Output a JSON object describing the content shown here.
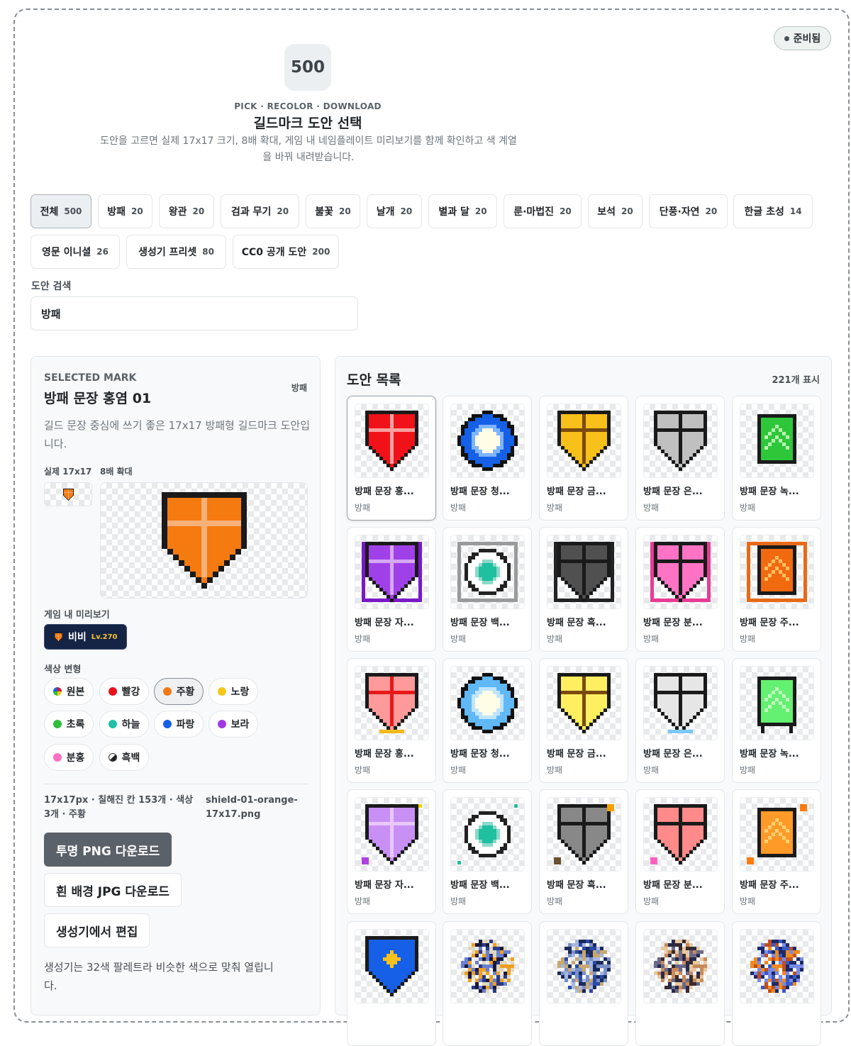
{
  "status": {
    "label": "준비됨"
  },
  "hero": {
    "count": "500",
    "eyebrow": "PICK · RECOLOR · DOWNLOAD",
    "title": "길드마크 도안 선택",
    "description": "도안을 고르면 실제 17x17 크기, 8배 확대, 게임 내 네임플레이트 미리보기를 함께 확인하고 색 계열을 바꿔 내려받습니다."
  },
  "filters": [
    {
      "label": "전체",
      "count": "500",
      "active": true
    },
    {
      "label": "방패",
      "count": "20"
    },
    {
      "label": "왕관",
      "count": "20"
    },
    {
      "label": "검과 무기",
      "count": "20"
    },
    {
      "label": "불꽃",
      "count": "20"
    },
    {
      "label": "날개",
      "count": "20"
    },
    {
      "label": "별과 달",
      "count": "20"
    },
    {
      "label": "룬·마법진",
      "count": "20"
    },
    {
      "label": "보석",
      "count": "20"
    },
    {
      "label": "단풍·자연",
      "count": "20"
    },
    {
      "label": "한글 초성",
      "count": "14"
    },
    {
      "label": "영문 이니셜",
      "count": "26"
    },
    {
      "label": "생성기 프리셋",
      "count": "80"
    },
    {
      "label": "CC0 공개 도안",
      "count": "200"
    }
  ],
  "search": {
    "label": "도안 검색",
    "value": "방패"
  },
  "selected": {
    "eyebrow": "SELECTED MARK",
    "title": "방패 문장 홍염 01",
    "category": "방패",
    "description": "길드 문장 중심에 쓰기 좋은 17x17 방패형 길드마크 도안입니다.",
    "actual_label": "실제 17x17",
    "zoom_label": "8배 확대",
    "preview_label": "게임 내 미리보기",
    "nameplate": {
      "name": "비비",
      "level": "Lv.270"
    },
    "color_label": "색상 변형",
    "swatches": [
      {
        "label": "원본",
        "color": "multi"
      },
      {
        "label": "빨강",
        "color": "#e8121c"
      },
      {
        "label": "주황",
        "color": "#f07a16",
        "active": true
      },
      {
        "label": "노랑",
        "color": "#f7c61a"
      },
      {
        "label": "초록",
        "color": "#2ebf3a"
      },
      {
        "label": "하늘",
        "color": "#1fc2a8"
      },
      {
        "label": "파랑",
        "color": "#1561e8"
      },
      {
        "label": "보라",
        "color": "#9d3be0"
      },
      {
        "label": "분홍",
        "color": "#ff6fc2"
      },
      {
        "label": "흑백",
        "color": "mono"
      }
    ],
    "meta": "17x17px · 칠해진 칸 153개 · 색상 3개 · 주황",
    "filename": "shield-01-orange-17x17.png",
    "buttons": {
      "png": "투명 PNG 다운로드",
      "jpg": "흰 배경 JPG 다운로드",
      "edit": "생성기에서 편집"
    },
    "note": "생성기는 32색 팔레트라 비슷한 색으로 맞춰 열립니다."
  },
  "list": {
    "title": "도안 목록",
    "count": "221개 표시",
    "items": [
      {
        "name": "방패 문장 홍...",
        "category": "방패",
        "icon": "shield-red-icon"
      },
      {
        "name": "방패 문장 청...",
        "category": "방패",
        "icon": "sun-blue-icon"
      },
      {
        "name": "방패 문장 금...",
        "category": "방패",
        "icon": "shield-gold-icon"
      },
      {
        "name": "방패 문장 은...",
        "category": "방패",
        "icon": "shield-silver-icon"
      },
      {
        "name": "방패 문장 녹...",
        "category": "방패",
        "icon": "banner-green-icon"
      },
      {
        "name": "방패 문장 자...",
        "category": "방패",
        "icon": "shield-purple-framed-icon"
      },
      {
        "name": "방패 문장 백...",
        "category": "방패",
        "icon": "target-white-framed-icon"
      },
      {
        "name": "방패 문장 흑...",
        "category": "방패",
        "icon": "shield-black-framed-icon"
      },
      {
        "name": "방패 문장 분...",
        "category": "방패",
        "icon": "shield-pink-framed-icon"
      },
      {
        "name": "방패 문장 주...",
        "category": "방패",
        "icon": "banner-orange-framed-icon"
      },
      {
        "name": "방패 문장 홍...",
        "category": "방패",
        "icon": "shield-lightred-icon"
      },
      {
        "name": "방패 문장 청...",
        "category": "방패",
        "icon": "sun-lightblue-icon"
      },
      {
        "name": "방패 문장 금...",
        "category": "방패",
        "icon": "shield-yellow-icon"
      },
      {
        "name": "방패 문장 은...",
        "category": "방패",
        "icon": "shield-lightsilver-icon"
      },
      {
        "name": "방패 문장 녹...",
        "category": "방패",
        "icon": "banner-lightgreen-icon"
      },
      {
        "name": "방패 문장 자...",
        "category": "방패",
        "icon": "shield-lavender-icon"
      },
      {
        "name": "방패 문장 백...",
        "category": "방패",
        "icon": "target-teal-icon"
      },
      {
        "name": "방패 문장 흑...",
        "category": "방패",
        "icon": "shield-gray-icon"
      },
      {
        "name": "방패 문장 분...",
        "category": "방패",
        "icon": "shield-salmon-icon"
      },
      {
        "name": "방패 문장 주...",
        "category": "방패",
        "icon": "banner-amber-icon"
      },
      {
        "name": "",
        "category": "",
        "icon": "shield-blue-icon"
      },
      {
        "name": "",
        "category": "",
        "icon": "dragon-icon"
      },
      {
        "name": "",
        "category": "",
        "icon": "orb-icon"
      },
      {
        "name": "",
        "category": "",
        "icon": "beast-icon"
      },
      {
        "name": "",
        "category": "",
        "icon": "golem-icon"
      }
    ]
  }
}
